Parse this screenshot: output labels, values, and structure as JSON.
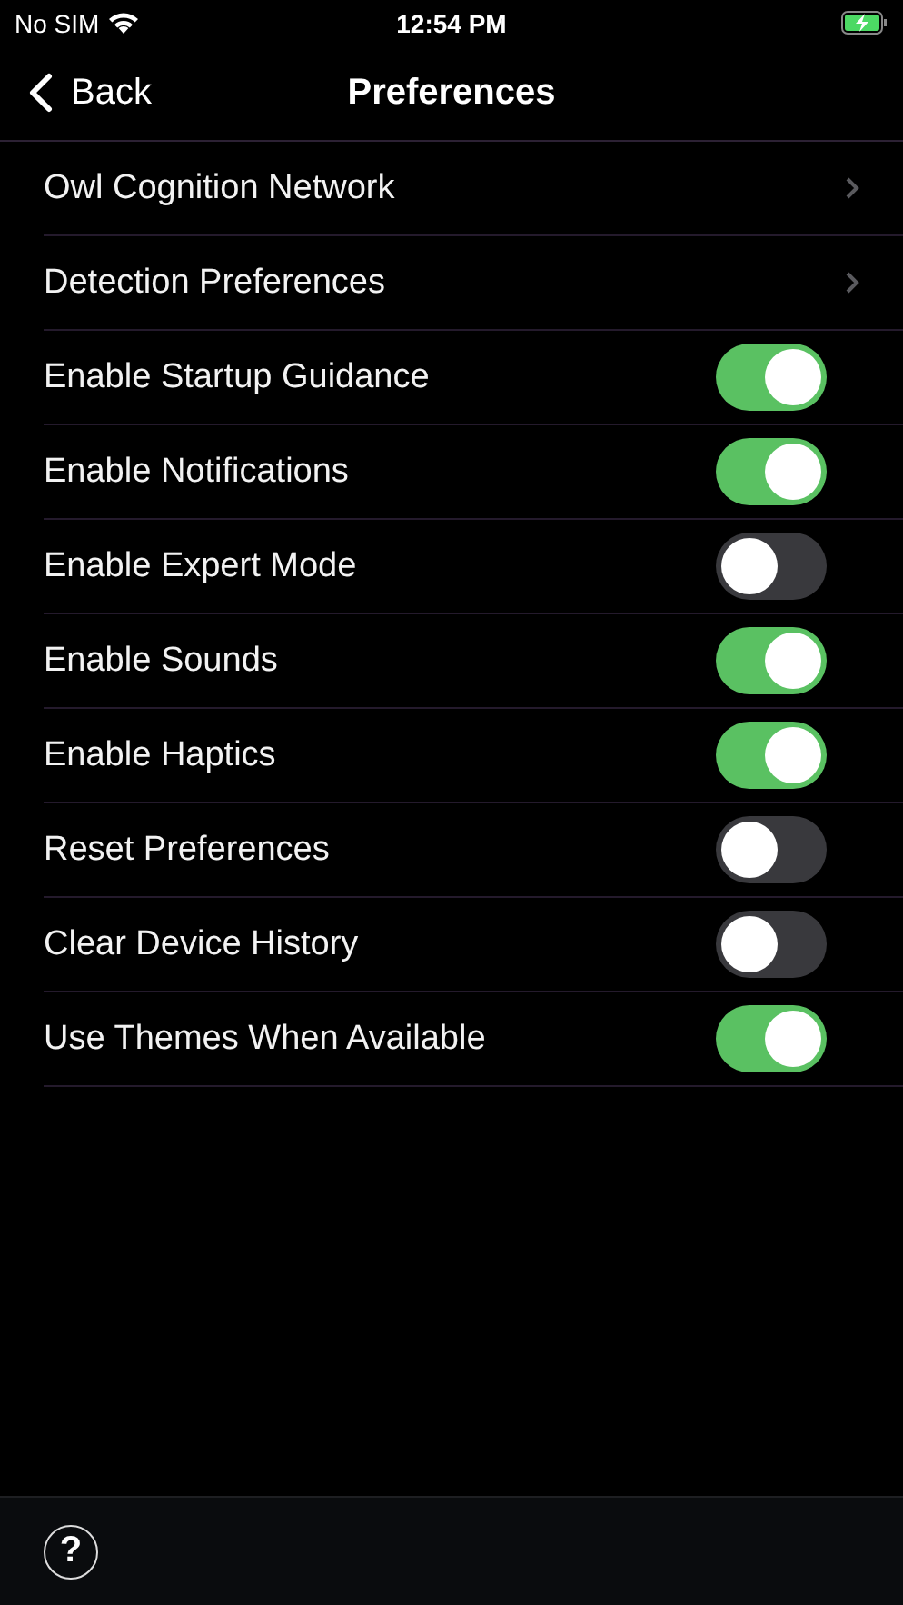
{
  "status_bar": {
    "carrier": "No SIM",
    "time": "12:54 PM"
  },
  "nav": {
    "back": "Back",
    "title": "Preferences"
  },
  "rows": [
    {
      "label": "Owl Cognition Network",
      "kind": "link"
    },
    {
      "label": "Detection Preferences",
      "kind": "link"
    },
    {
      "label": "Enable Startup Guidance",
      "kind": "toggle",
      "on": true
    },
    {
      "label": "Enable Notifications",
      "kind": "toggle",
      "on": true
    },
    {
      "label": "Enable Expert Mode",
      "kind": "toggle",
      "on": false
    },
    {
      "label": "Enable Sounds",
      "kind": "toggle",
      "on": true
    },
    {
      "label": "Enable Haptics",
      "kind": "toggle",
      "on": true
    },
    {
      "label": "Reset Preferences",
      "kind": "toggle",
      "on": false
    },
    {
      "label": "Clear Device History",
      "kind": "toggle",
      "on": false
    },
    {
      "label": "Use Themes When Available",
      "kind": "toggle",
      "on": true
    }
  ],
  "toolbar": {
    "help": "?"
  }
}
